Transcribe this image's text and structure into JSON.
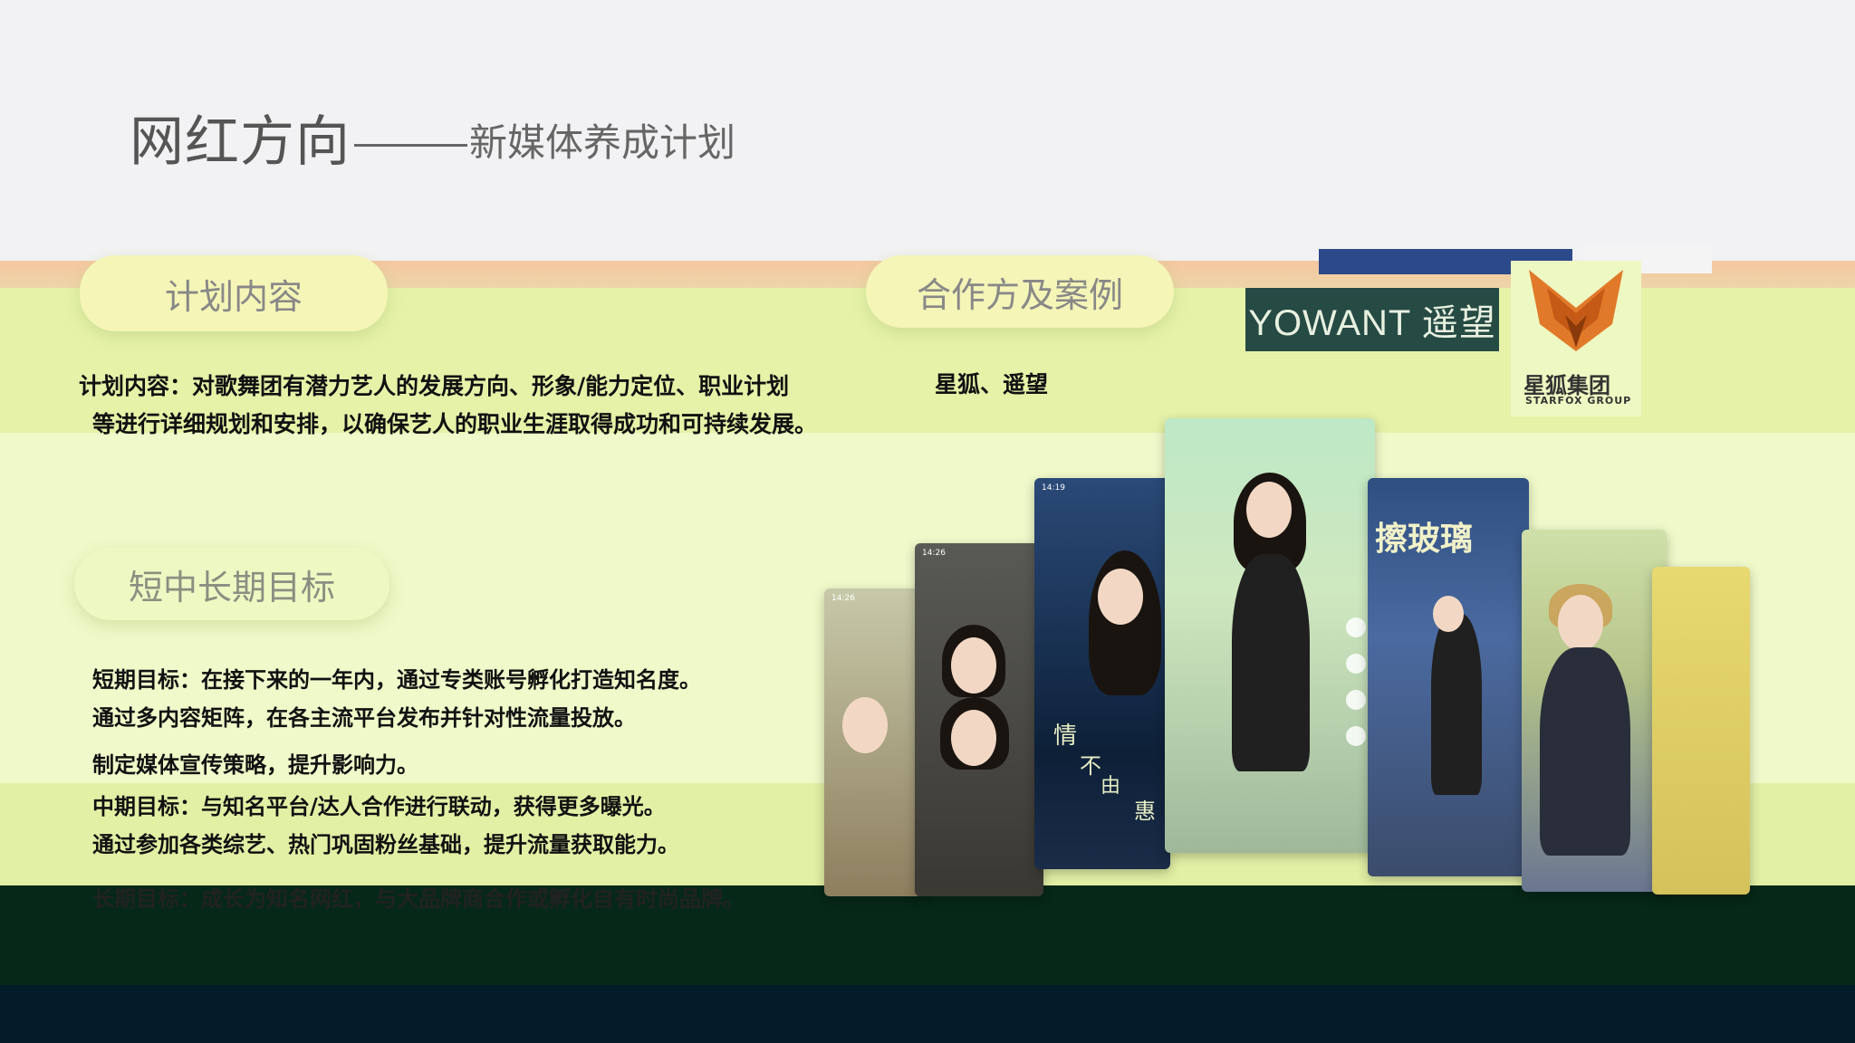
{
  "header": {
    "title_main": "网红方向",
    "title_sub": "新媒体养成计划"
  },
  "sections": {
    "plan_title": "计划内容",
    "cooperation_title": "合作方及案例",
    "goals_title": "短中长期目标"
  },
  "plan": {
    "line1": "计划内容：对歌舞团有潜力艺人的发展方向、形象/能力定位、职业计划",
    "line2": "等进行详细规划和安排，以确保艺人的职业生涯取得成功和可持续发展。"
  },
  "cooperation": {
    "partners": "星狐、遥望",
    "logo_yowant": "YOWANT 遥望",
    "logo_starfox_cn": "星狐集团",
    "logo_starfox_en": "STARFOX GROUP"
  },
  "goals": {
    "short_1": "短期目标：在接下来的一年内，通过专类账号孵化打造知名度。",
    "short_2": "通过多内容矩阵，在各主流平台发布并针对性流量投放。",
    "short_3": "制定媒体宣传策略，提升影响力。",
    "mid_1": "中期目标：与知名平台/达人合作进行联动，获得更多曝光。",
    "mid_2": "通过参加各类综艺、热门巩固粉丝基础，提升流量获取能力。",
    "long_1": "长期目标：成长为知名网红，与大品牌商合作或孵化自有时尚品牌。"
  },
  "phones": {
    "time_1": "14:26",
    "time_2": "14:19",
    "tag_glass": "擦玻璃",
    "tag_qing": "情",
    "tag_bu": "不",
    "tag_you": "由",
    "tag_hui": "惠"
  },
  "colors": {
    "background": "#f2f2f4",
    "band_lime": "#e5f2a8",
    "band_pale": "#eff9c9",
    "band_dark": "#062818",
    "pill": "#f4f5b6",
    "text": "#111111"
  }
}
